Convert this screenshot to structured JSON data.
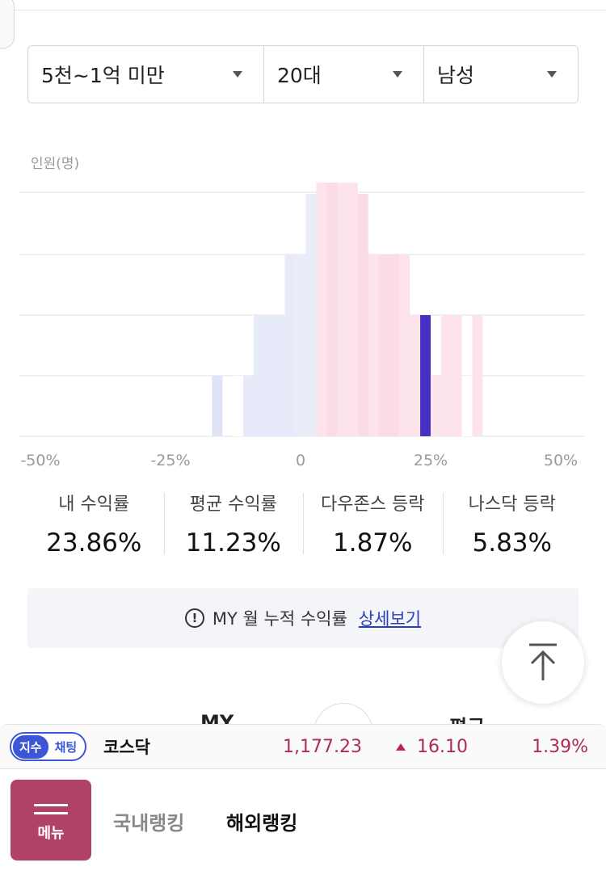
{
  "filters": [
    {
      "value": "5천~1억 미만"
    },
    {
      "value": "20대"
    },
    {
      "value": "남성"
    }
  ],
  "unit_label": "인원(명)",
  "chart_data": {
    "type": "bar",
    "x_ticks": [
      "-50%",
      "-25%",
      "0",
      "25%",
      "50%"
    ],
    "xlim": [
      -50,
      50
    ],
    "bars": [
      {
        "x": -16,
        "y": 1,
        "color": "#dfe3f5"
      },
      {
        "x": -12,
        "y": 1,
        "color": "#ffffff"
      },
      {
        "x": -10,
        "y": 1,
        "color": "#e7eaf8"
      },
      {
        "x": -8,
        "y": 2,
        "color": "#e7eaf8"
      },
      {
        "x": -6,
        "y": 2,
        "color": "#e7eaf8"
      },
      {
        "x": -4,
        "y": 2,
        "color": "#e7eaf8"
      },
      {
        "x": -2,
        "y": 3,
        "color": "#e7eaf8"
      },
      {
        "x": 0,
        "y": 3,
        "color": "#e9ecf9"
      },
      {
        "x": 2,
        "y": 4,
        "color": "#e9ecf9"
      },
      {
        "x": 4,
        "y": 5,
        "color": "#fde3ea"
      },
      {
        "x": 6,
        "y": 6,
        "color": "#fbdbe4"
      },
      {
        "x": 8,
        "y": 6,
        "color": "#fde3ea"
      },
      {
        "x": 10,
        "y": 5,
        "color": "#fde3ea"
      },
      {
        "x": 12,
        "y": 4,
        "color": "#fbdbe4"
      },
      {
        "x": 14,
        "y": 3,
        "color": "#fde3ea"
      },
      {
        "x": 16,
        "y": 3,
        "color": "#fbdbe4"
      },
      {
        "x": 18,
        "y": 3,
        "color": "#fbdbe4"
      },
      {
        "x": 20,
        "y": 3,
        "color": "#fde3ea"
      },
      {
        "x": 22,
        "y": 2,
        "color": "#fde3ea"
      },
      {
        "x": 24,
        "y": 2,
        "color": "#4630c4"
      },
      {
        "x": 26,
        "y": 1,
        "color": "#fbe6ed"
      },
      {
        "x": 28,
        "y": 2,
        "color": "#fde3ea"
      },
      {
        "x": 30,
        "y": 2,
        "color": "#fde3ea"
      },
      {
        "x": 32,
        "y": 1,
        "color": "#ffffff"
      },
      {
        "x": 34,
        "y": 2,
        "color": "#fde3ea"
      }
    ],
    "highlight_color": "#4630c4",
    "negative_color": "#e7eaf8",
    "positive_color": "#fde3ea",
    "grid": true
  },
  "stats": [
    {
      "label": "내 수익률",
      "value": "23.86%"
    },
    {
      "label": "평균 수익률",
      "value": "11.23%"
    },
    {
      "label": "다우존스 등락",
      "value": "1.87%"
    },
    {
      "label": "나스닥 등락",
      "value": "5.83%"
    }
  ],
  "info": {
    "icon": "!",
    "text": "MY 월 누적 수익률",
    "link": "상세보기"
  },
  "peek": {
    "left": "MY",
    "right": "평균"
  },
  "ticker": {
    "badge_a": "지수",
    "badge_b": "채팅",
    "name": "코스닥",
    "price": "1,177.23",
    "change": "16.10",
    "rate": "1.39%",
    "color": "#b0295a"
  },
  "bottom_nav": {
    "menu_label": "메뉴",
    "tabs": [
      "국내랭킹",
      "해외랭킹"
    ],
    "menu_color": "#b04269"
  }
}
